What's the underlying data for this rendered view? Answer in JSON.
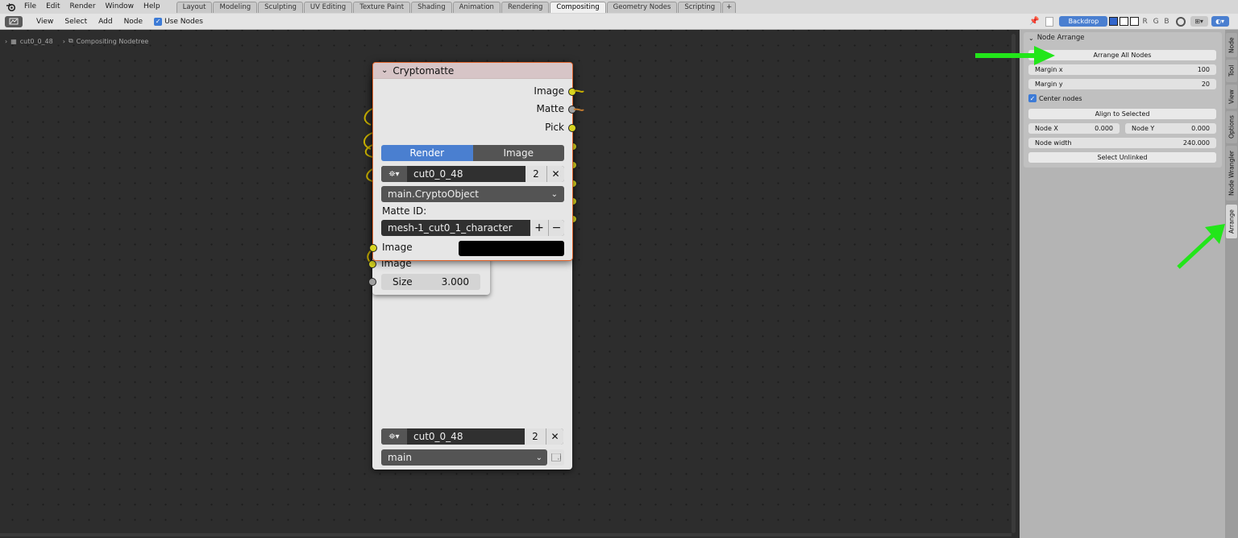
{
  "menu": [
    "File",
    "Edit",
    "Render",
    "Window",
    "Help"
  ],
  "workspaces": [
    "Layout",
    "Modeling",
    "Sculpting",
    "UV Editing",
    "Texture Paint",
    "Shading",
    "Animation",
    "Rendering",
    "Compositing",
    "Geometry Nodes",
    "Scripting",
    "+"
  ],
  "active_workspace": "Compositing",
  "header": {
    "view": "View",
    "select": "Select",
    "add": "Add",
    "node": "Node",
    "use_nodes": "Use Nodes",
    "backdrop": "Backdrop",
    "channels": "R G B"
  },
  "breadcrumb": {
    "scene": "cut0_0_48",
    "tree": "Compositing Nodetree"
  },
  "panel": {
    "title": "Node Arrange",
    "arrange_all": "Arrange All Nodes",
    "margin_x_label": "Margin x",
    "margin_x": "100",
    "margin_y_label": "Margin y",
    "margin_y": "20",
    "center_nodes": "Center nodes",
    "align_selected": "Align to Selected",
    "node_x_label": "Node X",
    "node_x": "0.000",
    "node_y_label": "Node Y",
    "node_y": "0.000",
    "node_width_label": "Node width",
    "node_width": "240.000",
    "select_unlinked": "Select Unlinked"
  },
  "side_tabs": [
    "Node",
    "Tool",
    "View",
    "Options",
    "Node Wrangler",
    "Arrange"
  ],
  "crypto": {
    "title": "Cryptomatte",
    "out_image": "Image",
    "out_matte": "Matte",
    "out_pick": "Pick",
    "mode_render": "Render",
    "mode_image": "Image",
    "scene": "cut0_0_48",
    "users": "2",
    "layer": "main.CryptoObject",
    "matte_label": "Matte ID:",
    "matte_value": "mesh-1_cut0_1_character",
    "in_image": "Image"
  },
  "blur": {
    "in_image": "Image",
    "size_label": "Size",
    "size_value": "3.000"
  },
  "back": {
    "scene": "cut0_0_48",
    "users": "2",
    "layer": "main"
  },
  "colors": {
    "accent": "#4a7fd0",
    "arrow": "#22e61a",
    "node_border": "#e0642c"
  }
}
